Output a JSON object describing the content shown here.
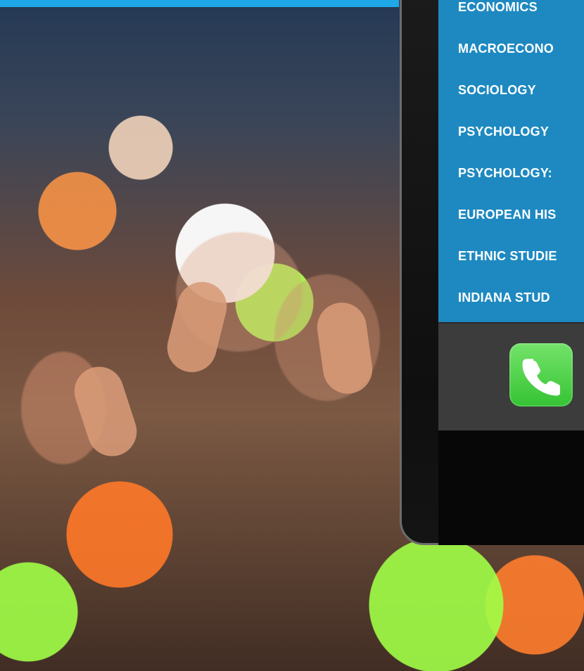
{
  "screen": {
    "menu_items": [
      {
        "label": "ECONOMICS"
      },
      {
        "label": "MACROECONO"
      },
      {
        "label": "SOCIOLOGY"
      },
      {
        "label": "PSYCHOLOGY"
      },
      {
        "label": "PSYCHOLOGY:"
      },
      {
        "label": "EUROPEAN HIS"
      },
      {
        "label": "ETHNIC STUDIE"
      },
      {
        "label": "INDIANA STUD"
      }
    ]
  },
  "dock": {
    "app_icon": "phone-icon"
  },
  "colors": {
    "top_band": "#1fa8e8",
    "screen_background": "#1e89c1",
    "menu_text": "#ffffff",
    "dock_background": "#3c3c3c",
    "phone_icon_green": "#35c334"
  }
}
